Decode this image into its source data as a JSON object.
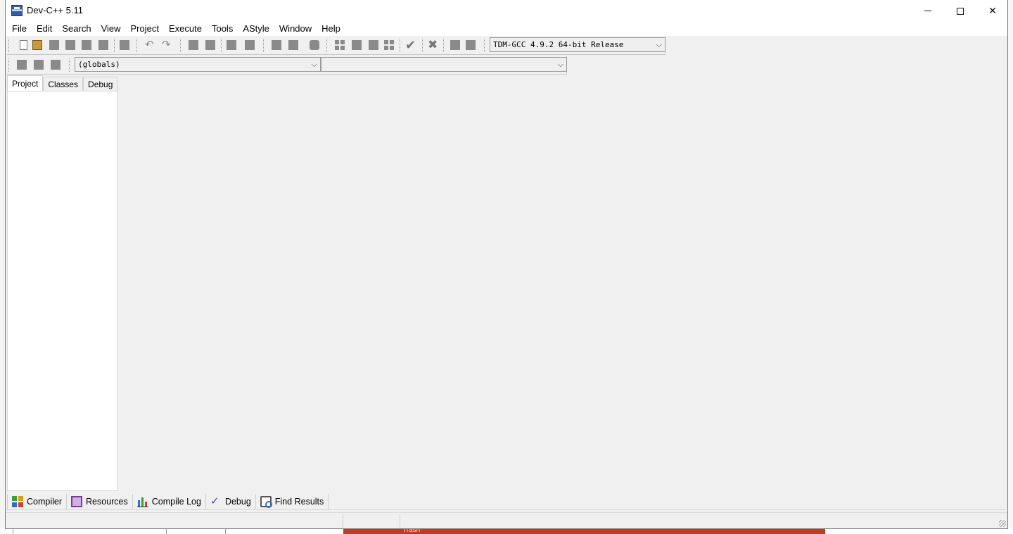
{
  "window": {
    "title": "Dev-C++ 5.11"
  },
  "menu": [
    "File",
    "Edit",
    "Search",
    "View",
    "Project",
    "Execute",
    "Tools",
    "AStyle",
    "Window",
    "Help"
  ],
  "toolbar": {
    "compiler_select": "TDM-GCC 4.9.2 64-bit Release",
    "scope_select": "(globals)",
    "symbol_select": ""
  },
  "left_tabs": [
    "Project",
    "Classes",
    "Debug"
  ],
  "bottom_tabs": [
    "Compiler",
    "Resources",
    "Compile Log",
    "Debug",
    "Find Results"
  ],
  "desktop": {
    "taskbar_text": "Trash"
  }
}
